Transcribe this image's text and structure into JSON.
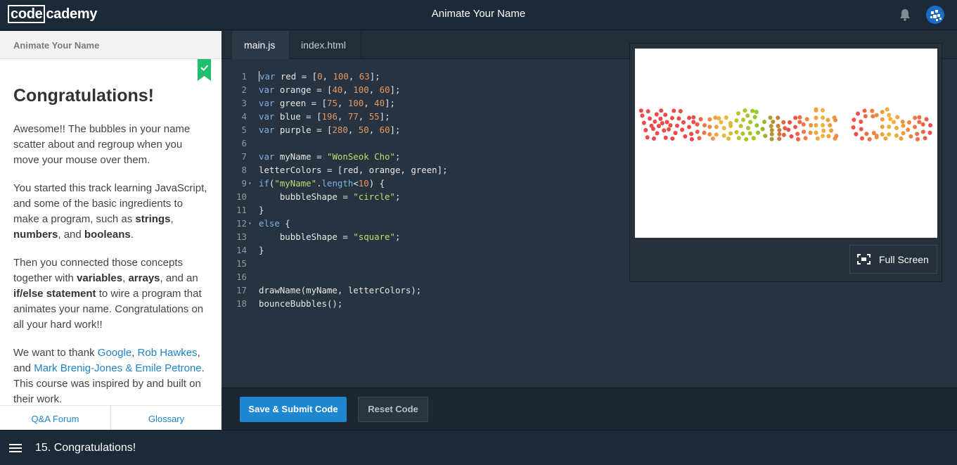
{
  "header": {
    "logo_box": "code",
    "logo_rest": "cademy",
    "title": "Animate Your Name"
  },
  "lesson": {
    "section_title": "Animate Your Name",
    "heading": "Congratulations!",
    "p1": "Awesome!! The bubbles in your name scatter about and regroup when you move your mouse over them.",
    "p2_a": "You started this track learning JavaScript, and some of the basic ingredients to make a program, such as ",
    "p2_strings": "strings",
    "p2_comma1": ", ",
    "p2_numbers": "numbers",
    "p2_and": ", and ",
    "p2_booleans": "booleans",
    "p2_end": ".",
    "p3_a": "Then you connected those concepts together with ",
    "p3_variables": "variables",
    "p3_comma": ", ",
    "p3_arrays": "arrays",
    "p3_and": ", and an ",
    "p3_ifelse": "if/else statement",
    "p3_end": " to wire a program that animates your name. Congratulations on all your hard work!!",
    "p4_a": "We want to thank ",
    "p4_google": "Google",
    "p4_comma": ", ",
    "p4_rob": "Rob Hawkes",
    "p4_and": ", and ",
    "p4_mark": "Mark Brenig-Jones & Emile Petrone",
    "p4_end": ". This course was inspired by and built on their work."
  },
  "left_footer": {
    "qa": "Q&A Forum",
    "glossary": "Glossary"
  },
  "tabs": [
    {
      "label": "main.js",
      "active": true
    },
    {
      "label": "index.html",
      "active": false
    }
  ],
  "code_lines": [
    {
      "n": "1",
      "tokens": [
        [
          "kw",
          "var"
        ],
        [
          "src",
          " red = ["
        ],
        [
          "num",
          "0"
        ],
        [
          "src",
          ", "
        ],
        [
          "num",
          "100"
        ],
        [
          "src",
          ", "
        ],
        [
          "num",
          "63"
        ],
        [
          "src",
          "];"
        ]
      ]
    },
    {
      "n": "2",
      "tokens": [
        [
          "kw",
          "var"
        ],
        [
          "src",
          " orange = ["
        ],
        [
          "num",
          "40"
        ],
        [
          "src",
          ", "
        ],
        [
          "num",
          "100"
        ],
        [
          "src",
          ", "
        ],
        [
          "num",
          "60"
        ],
        [
          "src",
          "];"
        ]
      ]
    },
    {
      "n": "3",
      "tokens": [
        [
          "kw",
          "var"
        ],
        [
          "src",
          " green = ["
        ],
        [
          "num",
          "75"
        ],
        [
          "src",
          ", "
        ],
        [
          "num",
          "100"
        ],
        [
          "src",
          ", "
        ],
        [
          "num",
          "40"
        ],
        [
          "src",
          "];"
        ]
      ]
    },
    {
      "n": "4",
      "tokens": [
        [
          "kw",
          "var"
        ],
        [
          "src",
          " blue = ["
        ],
        [
          "num",
          "196"
        ],
        [
          "src",
          ", "
        ],
        [
          "num",
          "77"
        ],
        [
          "src",
          ", "
        ],
        [
          "num",
          "55"
        ],
        [
          "src",
          "];"
        ]
      ]
    },
    {
      "n": "5",
      "tokens": [
        [
          "kw",
          "var"
        ],
        [
          "src",
          " purple = ["
        ],
        [
          "num",
          "280"
        ],
        [
          "src",
          ", "
        ],
        [
          "num",
          "50"
        ],
        [
          "src",
          ", "
        ],
        [
          "num",
          "60"
        ],
        [
          "src",
          "];"
        ]
      ]
    },
    {
      "n": "6",
      "tokens": []
    },
    {
      "n": "7",
      "tokens": [
        [
          "kw",
          "var"
        ],
        [
          "src",
          " myName = "
        ],
        [
          "str",
          "\"WonSeok Cho\""
        ],
        [
          "src",
          ";"
        ]
      ]
    },
    {
      "n": "8",
      "tokens": [
        [
          "src",
          "letterColors = [red, orange, green];"
        ]
      ]
    },
    {
      "n": "9",
      "fold": true,
      "tokens": [
        [
          "kw",
          "if"
        ],
        [
          "src",
          "("
        ],
        [
          "str",
          "\"myName\""
        ],
        [
          "src",
          "."
        ],
        [
          "kw",
          "length"
        ],
        [
          "src",
          "<"
        ],
        [
          "num",
          "10"
        ],
        [
          "src",
          ") {"
        ]
      ]
    },
    {
      "n": "10",
      "tokens": [
        [
          "src",
          "    bubbleShape = "
        ],
        [
          "str",
          "\"circle\""
        ],
        [
          "src",
          ";"
        ]
      ]
    },
    {
      "n": "11",
      "tokens": [
        [
          "src",
          "}"
        ]
      ]
    },
    {
      "n": "12",
      "fold": true,
      "tokens": [
        [
          "kw",
          "else"
        ],
        [
          "src",
          " {"
        ]
      ]
    },
    {
      "n": "13",
      "tokens": [
        [
          "src",
          "    bubbleShape = "
        ],
        [
          "str",
          "\"square\""
        ],
        [
          "src",
          ";"
        ]
      ]
    },
    {
      "n": "14",
      "tokens": [
        [
          "src",
          "}"
        ]
      ]
    },
    {
      "n": "15",
      "tokens": []
    },
    {
      "n": "16",
      "tokens": []
    },
    {
      "n": "17",
      "tokens": [
        [
          "src",
          "drawName(myName, letterColors);"
        ]
      ]
    },
    {
      "n": "18",
      "tokens": [
        [
          "src",
          "bounceBubbles();"
        ]
      ]
    }
  ],
  "preview": {
    "display_name": "WonSeok Cho",
    "fullscreen_label": "Full Screen"
  },
  "actions": {
    "submit": "Save & Submit Code",
    "reset": "Reset Code"
  },
  "footer": {
    "step": "15. Congratulations!"
  },
  "colors": {
    "submit": "#1e87cf",
    "link": "#1e84c7",
    "ribbon": "#1fbf6e",
    "red": "#ef4a4a",
    "orange": "#f0b83a",
    "green": "#8ccb24"
  }
}
